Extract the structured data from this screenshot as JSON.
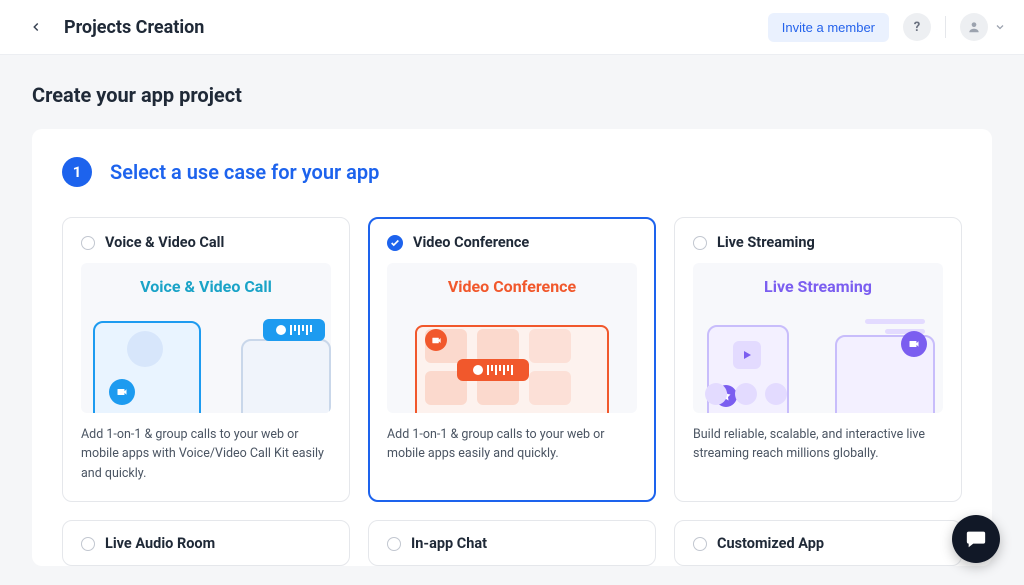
{
  "header": {
    "title": "Projects Creation",
    "invite_label": "Invite a member"
  },
  "page": {
    "heading": "Create your app project"
  },
  "step": {
    "number": "1",
    "title": "Select a use case for your app"
  },
  "cards": [
    {
      "title": "Voice & Video Call",
      "illus_label": "Voice & Video Call",
      "desc": "Add 1-on-1 & group calls to your web or mobile apps with Voice/Video Call Kit easily and quickly.",
      "selected": false
    },
    {
      "title": "Video Conference",
      "illus_label": "Video Conference",
      "desc": "Add 1-on-1 & group calls to your web or mobile apps easily and quickly.",
      "selected": true
    },
    {
      "title": "Live Streaming",
      "illus_label": "Live Streaming",
      "desc": "Build reliable, scalable, and interactive live streaming reach millions globally.",
      "selected": false
    },
    {
      "title": "Live Audio Room",
      "selected": false
    },
    {
      "title": "In-app Chat",
      "selected": false
    },
    {
      "title": "Customized App",
      "selected": false
    }
  ]
}
